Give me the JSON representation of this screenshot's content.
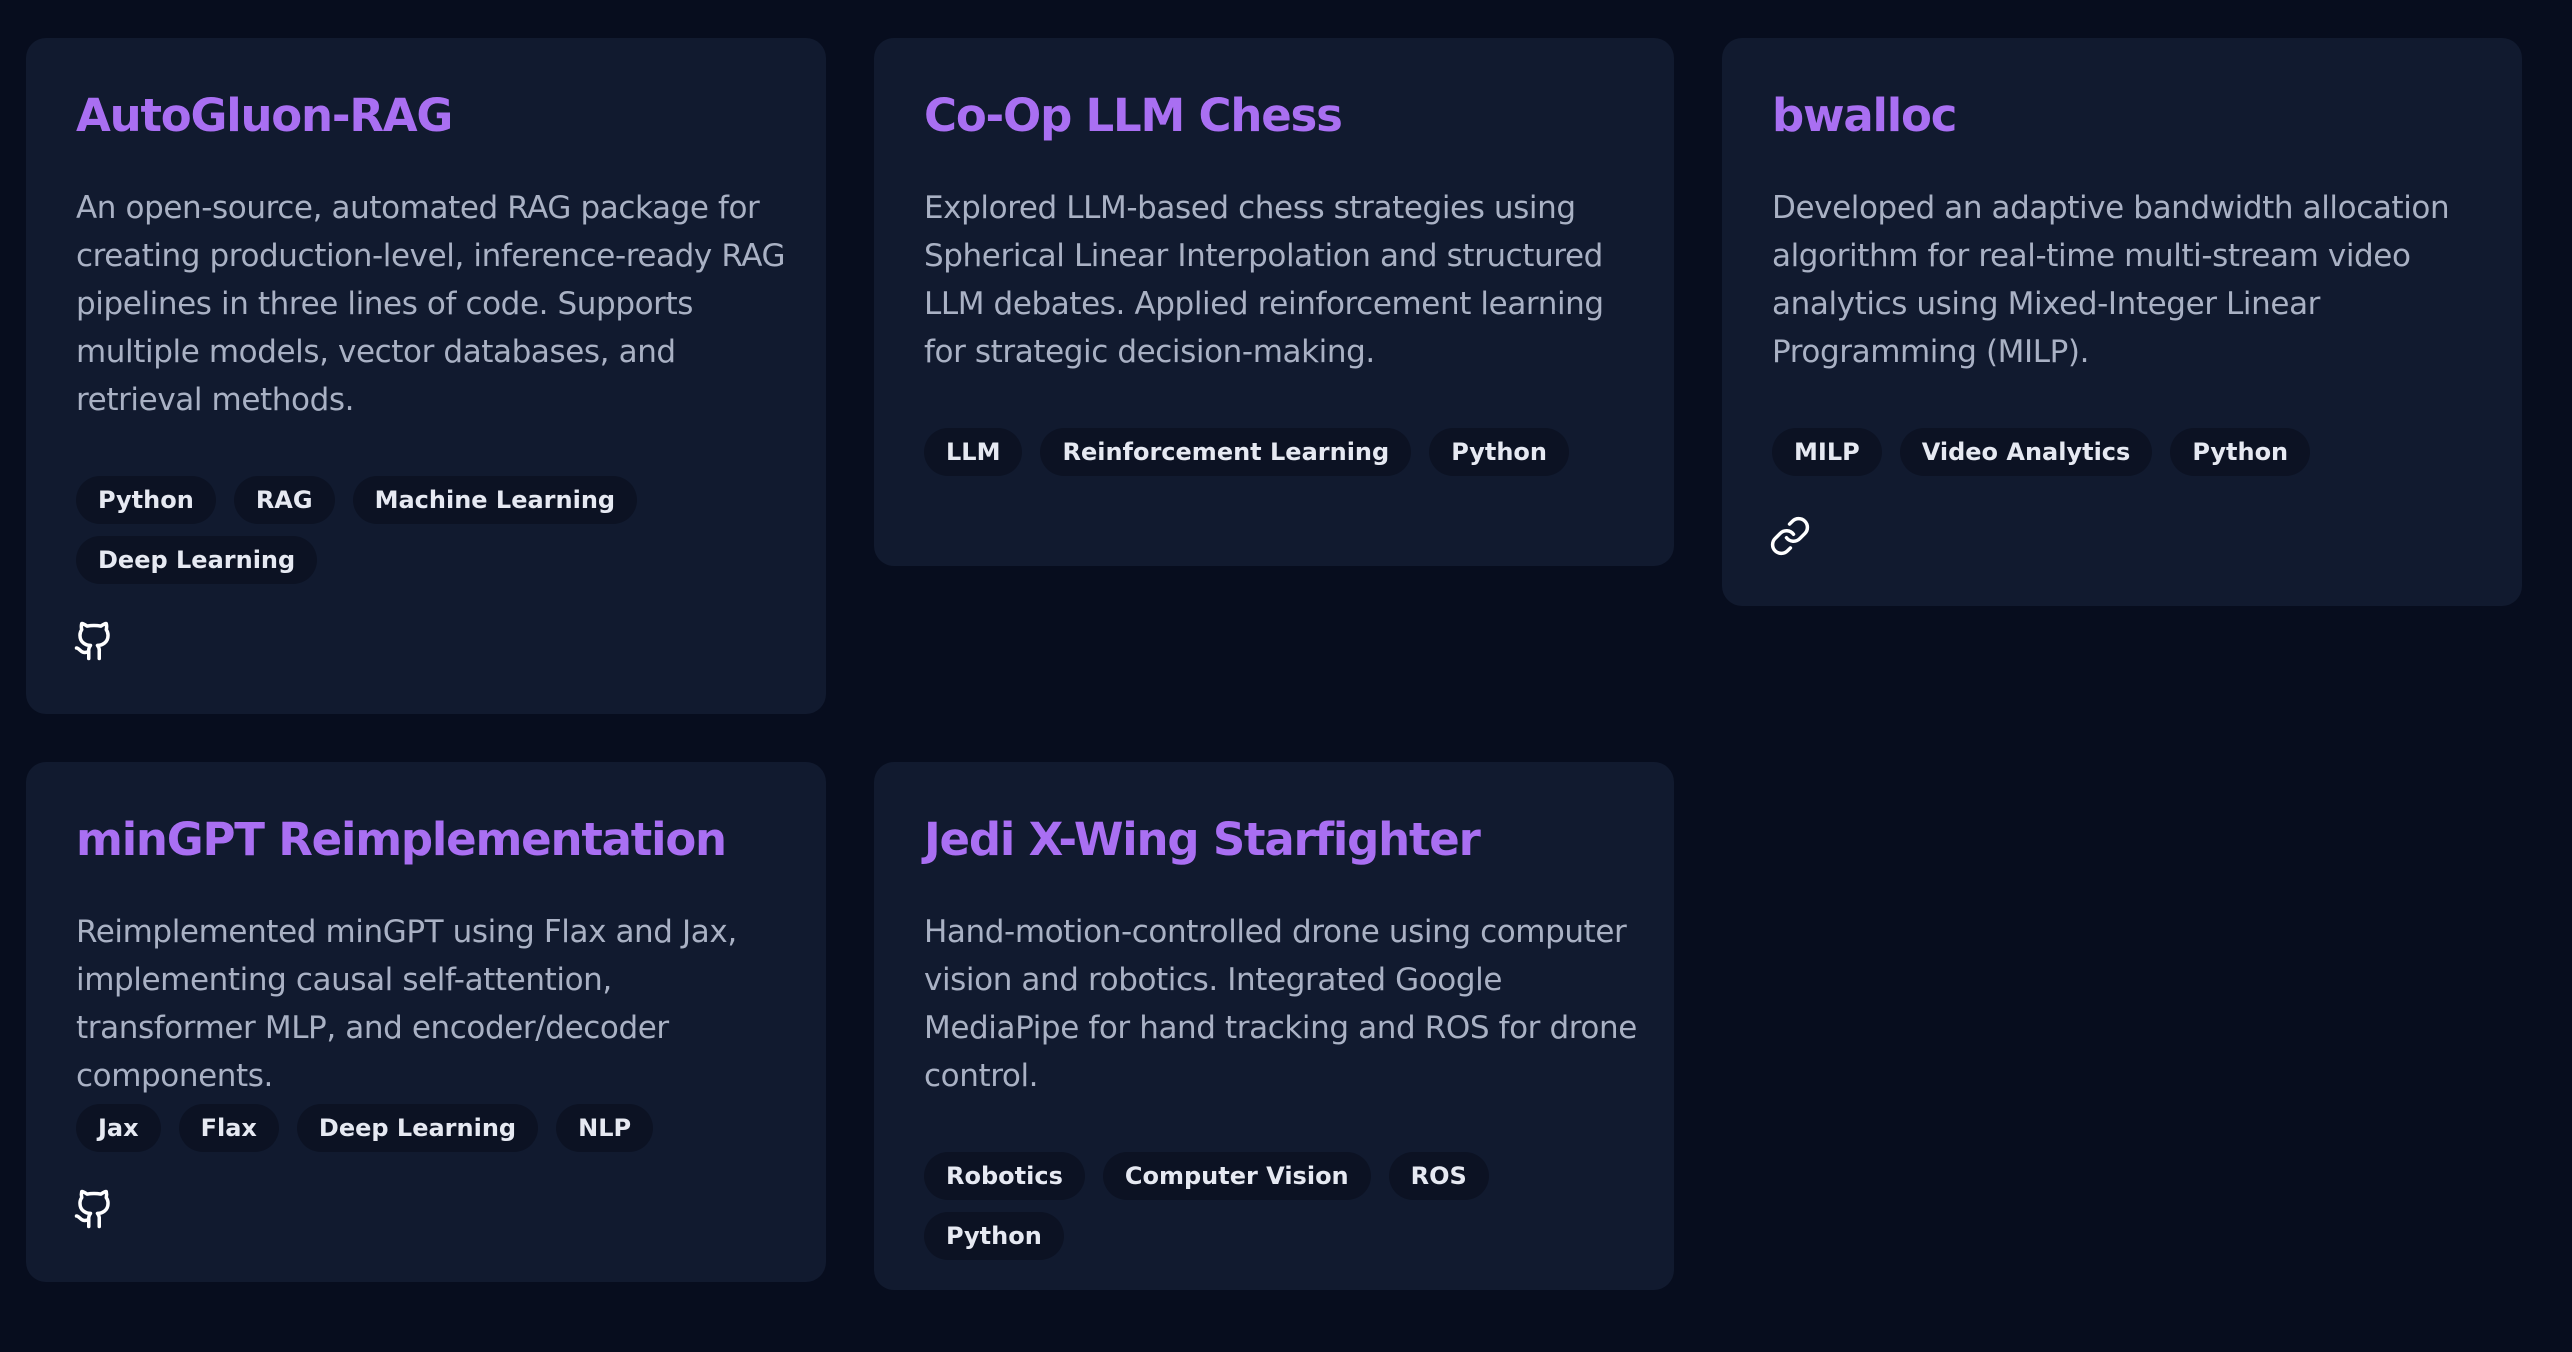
{
  "colors": {
    "background": "#070d1e",
    "card": "#111a2f",
    "title_accent": "#a96ff2",
    "description": "#a9b1c4",
    "tag_background": "#0c1223",
    "tag_text": "#e6e9f2"
  },
  "projects": [
    {
      "title": "AutoGluon-RAG",
      "description": "An open-source, automated RAG package for creating production-level, inference-ready RAG pipelines in three lines of code. Supports multiple models, vector databases, and retrieval methods.",
      "tags": [
        "Python",
        "RAG",
        "Machine Learning",
        "Deep Learning"
      ],
      "link_icon": "github-icon"
    },
    {
      "title": "Co-Op LLM Chess",
      "description": "Explored LLM-based chess strategies using Spherical Linear Interpolation and structured LLM debates. Applied reinforcement learning for strategic decision-making.",
      "tags": [
        "LLM",
        "Reinforcement Learning",
        "Python"
      ]
    },
    {
      "title": "bwalloc",
      "description": "Developed an adaptive bandwidth allocation algorithm for real-time multi-stream video analytics using Mixed-Integer Linear Programming (MILP).",
      "tags": [
        "MILP",
        "Video Analytics",
        "Python"
      ],
      "link_icon": "link-icon"
    },
    {
      "title": "minGPT Reimplementation",
      "description": "Reimplemented minGPT using Flax and Jax, implementing causal self-attention, transformer MLP, and encoder/decoder components.",
      "tags": [
        "Jax",
        "Flax",
        "Deep Learning",
        "NLP"
      ],
      "link_icon": "github-icon"
    },
    {
      "title": "Jedi X-Wing Starfighter",
      "description": "Hand-motion-controlled drone using computer vision and robotics. Integrated Google MediaPipe for hand tracking and ROS for drone control.",
      "tags": [
        "Robotics",
        "Computer Vision",
        "ROS",
        "Python"
      ]
    }
  ]
}
